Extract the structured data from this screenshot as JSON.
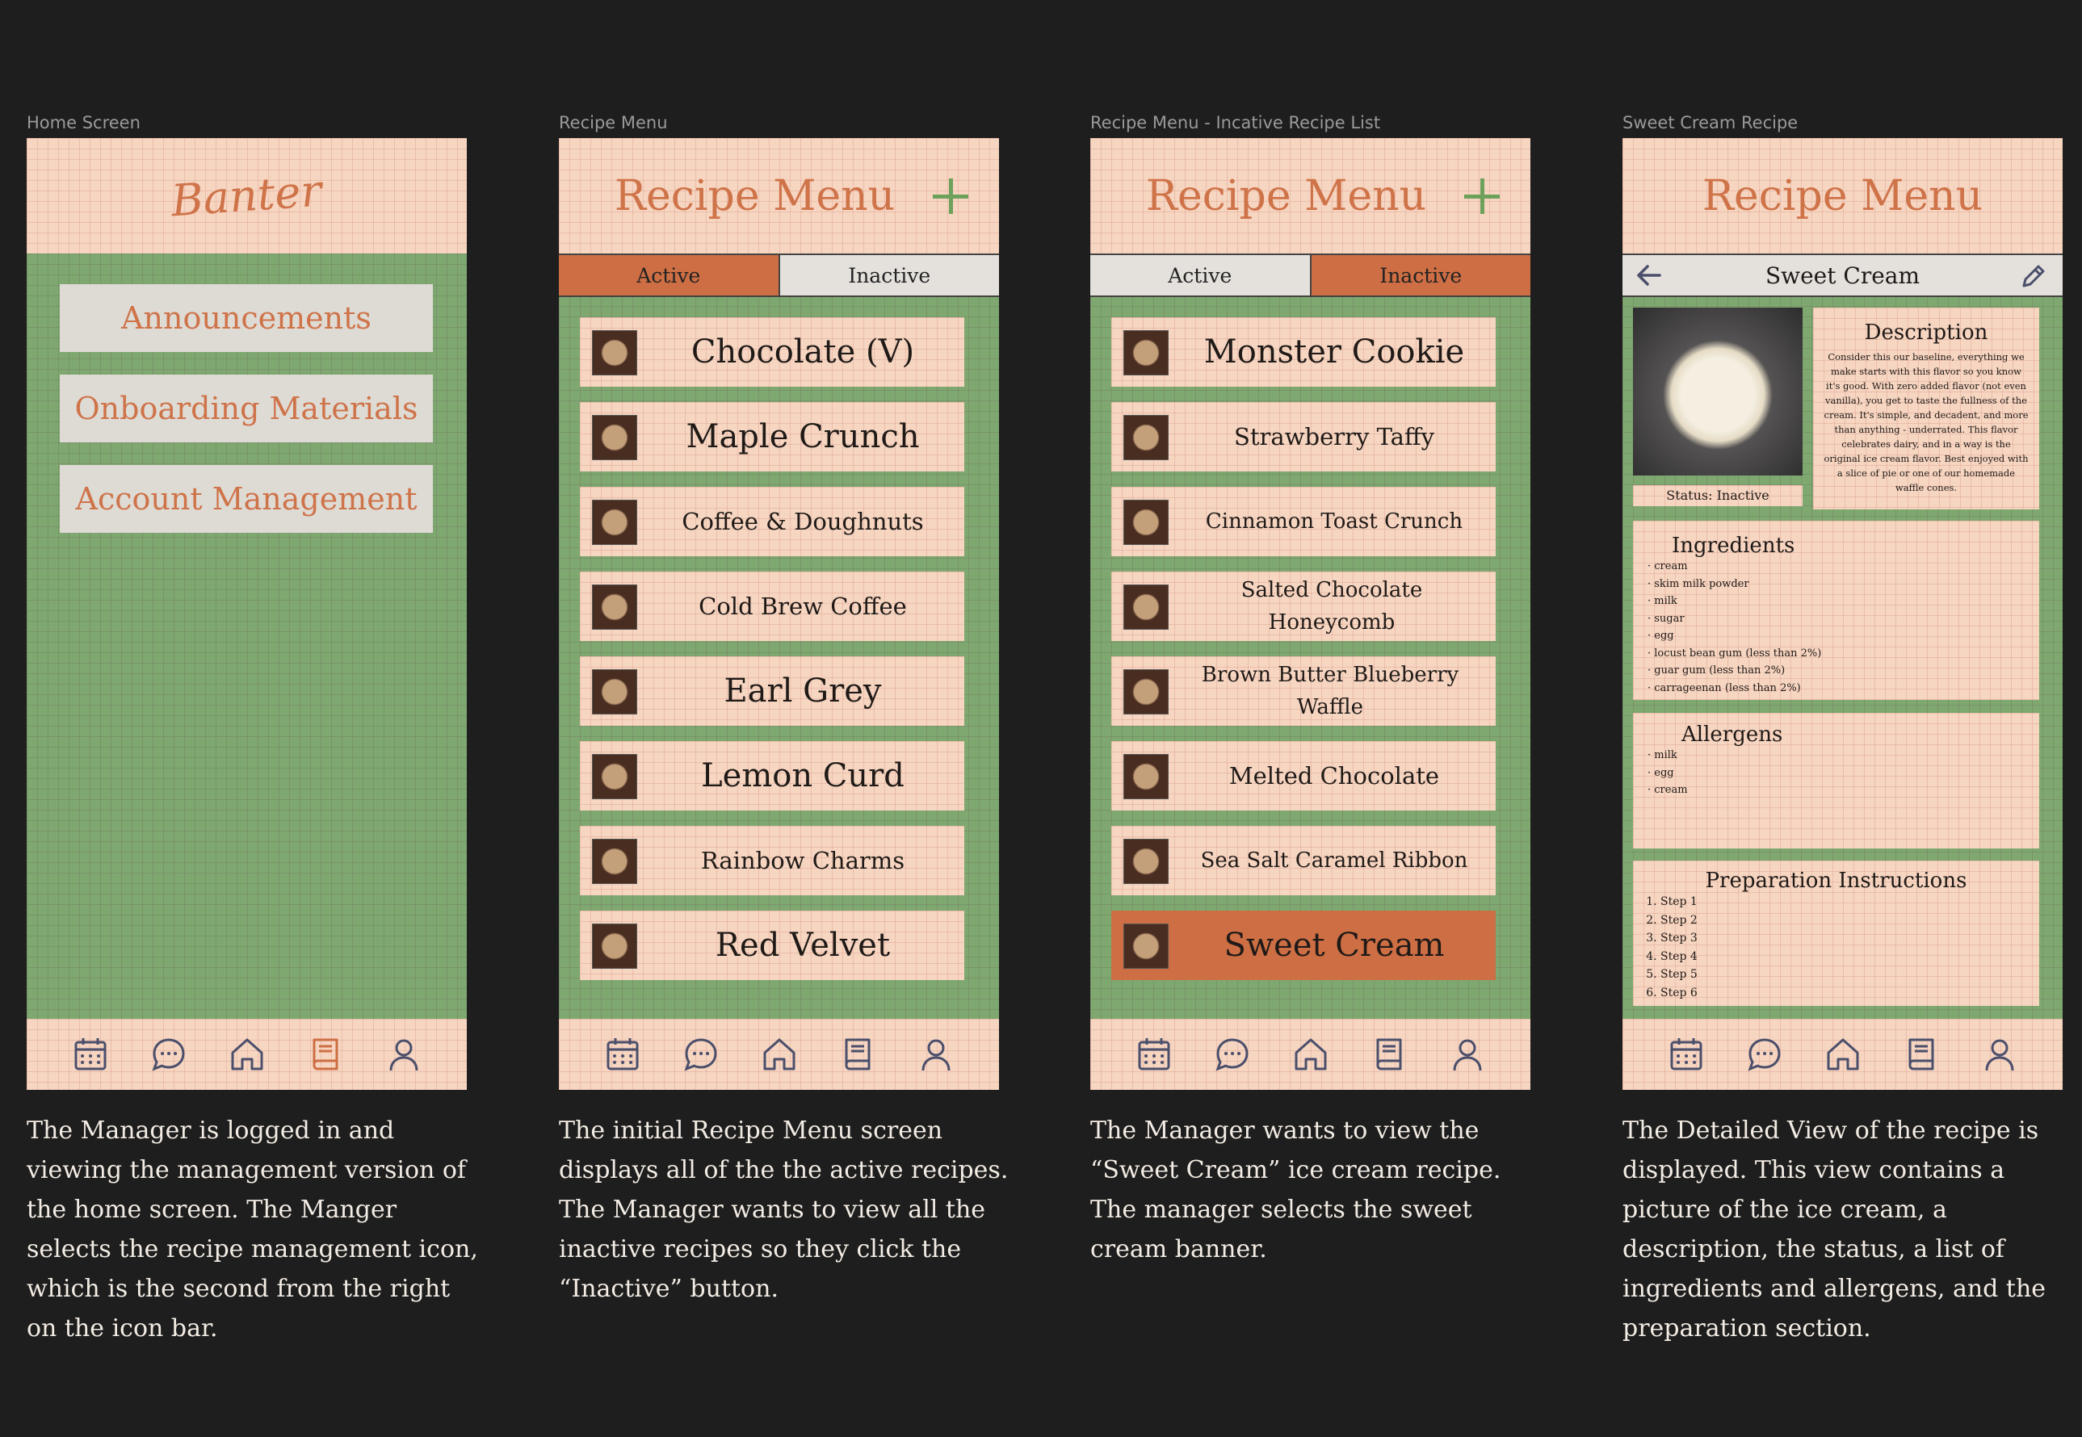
{
  "frames": [
    {
      "label": "Home Screen"
    },
    {
      "label": "Recipe Menu"
    },
    {
      "label": "Recipe Menu - Incative Recipe List"
    },
    {
      "label": "Sweet Cream Recipe"
    }
  ],
  "home": {
    "brand": "Banter",
    "buttons": [
      "Announcements",
      "Onboarding Materials",
      "Account Management"
    ]
  },
  "recipe_menu": {
    "title": "Recipe Menu",
    "tab_active": "Active",
    "tab_inactive": "Inactive",
    "active_items": [
      "Chocolate (V)",
      "Maple Crunch",
      "Coffee & Doughnuts",
      "Cold Brew Coffee",
      "Earl Grey",
      "Lemon Curd",
      "Rainbow Charms",
      "Red Velvet"
    ],
    "inactive_items": [
      "Monster Cookie",
      "Strawberry Taffy",
      "Cinnamon Toast Crunch",
      "Salted Chocolate Honeycomb",
      "Brown Butter Blueberry Waffle",
      "Melted Chocolate",
      "Sea Salt Caramel Ribbon",
      "Sweet Cream"
    ]
  },
  "detail": {
    "title": "Recipe Menu",
    "recipe_name": "Sweet Cream",
    "status": "Status: Inactive",
    "description_title": "Description",
    "description": "Consider this our baseline, everything we make starts with this flavor so you know it's good. With zero added flavor (not even vanilla), you get to taste the fullness of the cream. It's simple, and decadent, and more than anything - underrated. This flavor celebrates dairy, and in a way is the original ice cream flavor. Best enjoyed with a slice of pie or one of our homemade waffle cones.",
    "ingredients_title": "Ingredients",
    "ingredients": [
      "cream",
      "skim milk powder",
      "milk",
      "sugar",
      "egg",
      "locust bean gum (less than 2%)",
      "guar gum (less than 2%)",
      "carrageenan (less than 2%)"
    ],
    "allergens_title": "Allergens",
    "allergens": [
      "milk",
      "egg",
      "cream"
    ],
    "prep_title": "Preparation Instructions",
    "steps": [
      "Step 1",
      "Step 2",
      "Step 3",
      "Step 4",
      "Step 5",
      "Step 6"
    ]
  },
  "captions": [
    "The Manager is logged in and viewing the management version of the home screen. The Manger selects the recipe management icon, which is the second from the right on the icon bar.",
    "The initial Recipe Menu screen displays all of the the active recipes. The Manager wants to view all the inactive recipes so they click the “Inactive” button.",
    "The Manager wants to view the “Sweet Cream” ice cream recipe. The manager selects the sweet cream banner.",
    "The Detailed View of the recipe is displayed. This view contains a picture of the ice cream, a description, the status, a list of ingredients and allergens, and the preparation section."
  ],
  "tabbar_icons": [
    "calendar-icon",
    "chat-icon",
    "home-icon",
    "book-icon",
    "user-icon"
  ],
  "colors": {
    "background": "#1e1e1e",
    "header": "#f6d5c1",
    "accent": "#cd6e44",
    "green": "#7ea86f",
    "icon": "#4b4f6b"
  }
}
